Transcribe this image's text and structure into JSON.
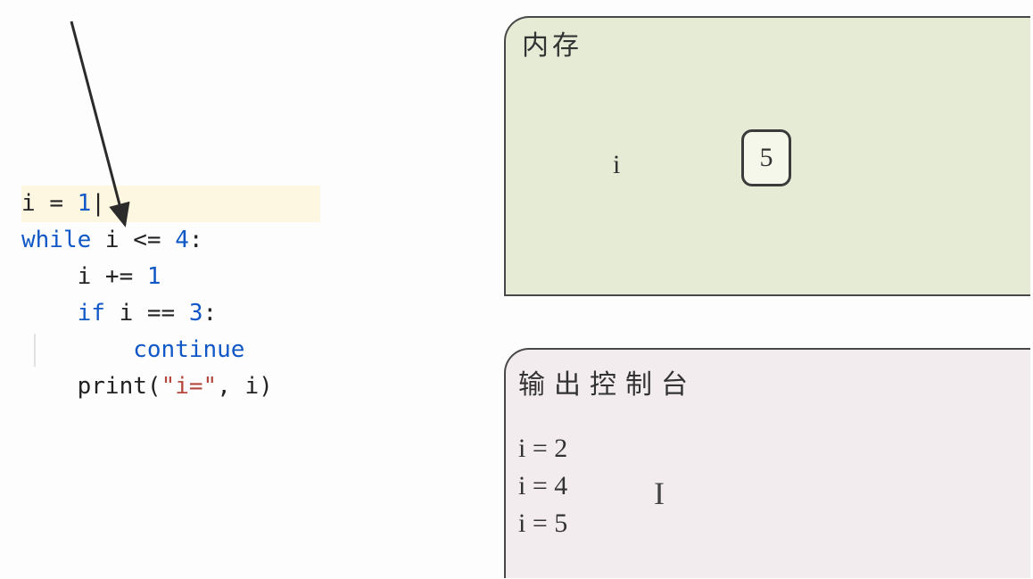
{
  "code": {
    "line1_var": "i ",
    "line1_op": "= ",
    "line1_val": "1",
    "line2_kw": "while ",
    "line2_cond_var": "i ",
    "line2_cond_op": "<= ",
    "line2_cond_val": "4",
    "line2_colon": ":",
    "line3": "    i += ",
    "line3_val": "1",
    "line4_a": "    ",
    "line4_kw": "if ",
    "line4_cond": "i == ",
    "line4_val": "3",
    "line4_colon": ":",
    "line5_a": "        ",
    "line5_kw": "continue",
    "line6_a": "    ",
    "line6_fn": "print",
    "line6_open": "(",
    "line6_str": "\"i=\"",
    "line6_rest": ", i)"
  },
  "memory": {
    "title": "内存",
    "var_name": "i",
    "var_value": "5"
  },
  "console": {
    "title": "输出控制台",
    "lines": {
      "0": "i = 2",
      "1": "i = 4",
      "2": "i = 5"
    }
  }
}
